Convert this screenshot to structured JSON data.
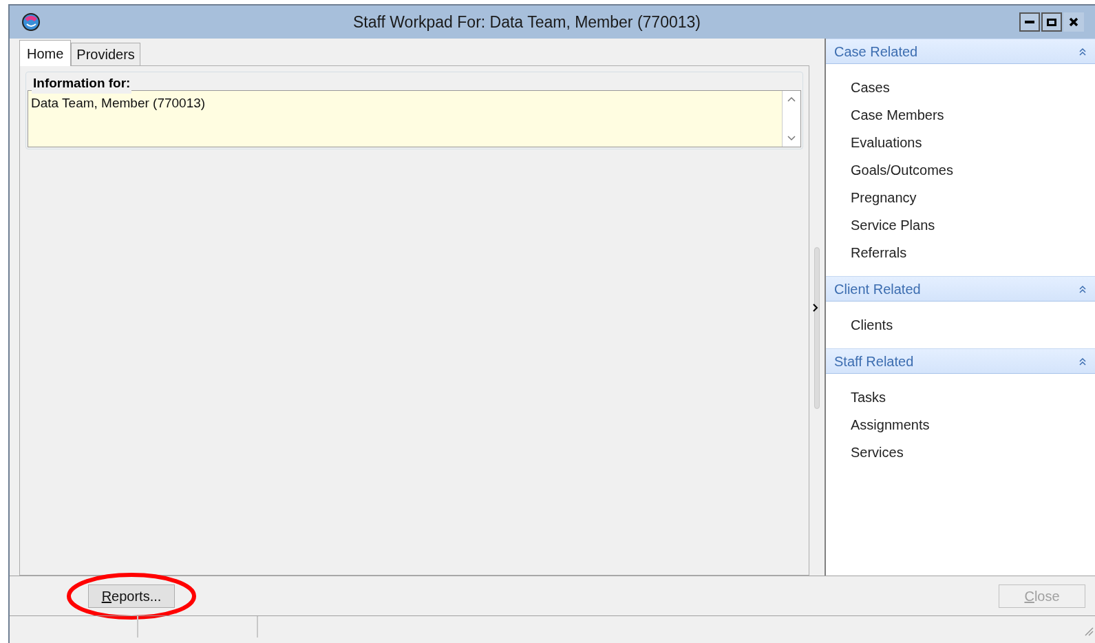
{
  "window": {
    "title": "Staff Workpad For: Data Team, Member (770013)"
  },
  "tabs": [
    {
      "label": "Home",
      "selected": true
    },
    {
      "label": "Providers",
      "selected": false
    }
  ],
  "information": {
    "label": "Information for:",
    "value": "Data Team, Member (770013)"
  },
  "sections": [
    {
      "title": "Case Related",
      "expanded": true,
      "items": [
        "Cases",
        "Case Members",
        "Evaluations",
        "Goals/Outcomes",
        "Pregnancy",
        "Service Plans",
        "Referrals"
      ]
    },
    {
      "title": "Client Related",
      "expanded": true,
      "items": [
        "Clients"
      ]
    },
    {
      "title": "Staff Related",
      "expanded": true,
      "items": [
        "Tasks",
        "Assignments",
        "Services"
      ]
    }
  ],
  "buttons": [
    {
      "label": "Reports...",
      "first_letter_underlined": true,
      "disabled": false,
      "highlighted": true
    },
    {
      "label": "Close",
      "first_letter_underlined": true,
      "disabled": true,
      "highlighted": false
    }
  ]
}
